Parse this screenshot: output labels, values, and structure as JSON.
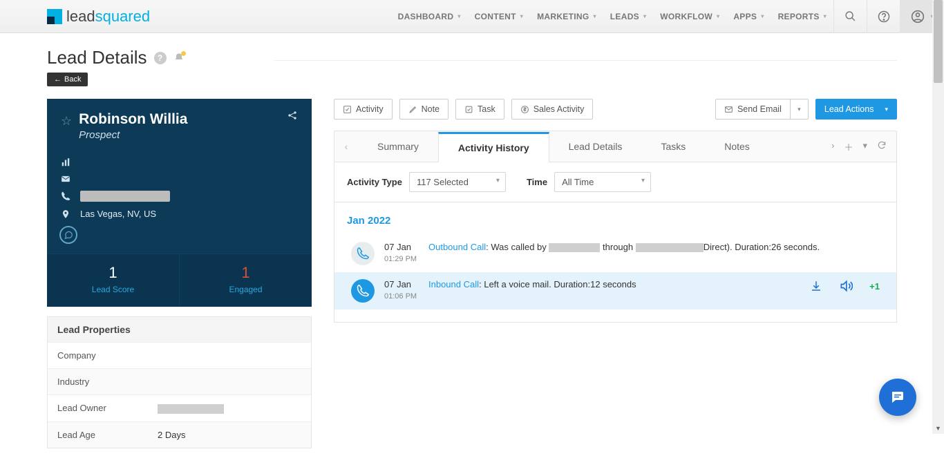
{
  "nav": {
    "brand_a": "lead",
    "brand_b": "squared",
    "items": [
      "DASHBOARD",
      "CONTENT",
      "MARKETING",
      "LEADS",
      "WORKFLOW",
      "APPS",
      "REPORTS"
    ]
  },
  "page": {
    "title": "Lead Details",
    "back": "Back"
  },
  "lead": {
    "name": "Robinson Willia",
    "stage": "Prospect",
    "location": "Las Vegas, NV, US",
    "score": {
      "value": "1",
      "label": "Lead Score"
    },
    "engaged": {
      "value": "1",
      "label": "Engaged"
    }
  },
  "props": {
    "header": "Lead Properties",
    "rows": [
      {
        "key": "Company",
        "val": ""
      },
      {
        "key": "Industry",
        "val": ""
      },
      {
        "key": "Lead Owner",
        "val": "[masked]"
      },
      {
        "key": "Lead Age",
        "val": "2 Days"
      }
    ]
  },
  "actions": {
    "activity": "Activity",
    "note": "Note",
    "task": "Task",
    "sales": "Sales Activity",
    "send_email": "Send Email",
    "lead_actions": "Lead Actions"
  },
  "tabs": [
    "Summary",
    "Activity History",
    "Lead Details",
    "Tasks",
    "Notes"
  ],
  "active_tab": 1,
  "filters": {
    "type_label": "Activity Type",
    "type_value": "117 Selected",
    "time_label": "Time",
    "time_value": "All Time"
  },
  "history": {
    "month": "Jan 2022",
    "rows": [
      {
        "kind": "out",
        "date": "07 Jan",
        "time": "01:29 PM",
        "link": "Outbound Call",
        "text_a": ": Was called by ",
        "mask_a_w": 74,
        "text_b": "through ",
        "mask_b_w": 98,
        "text_c": "Direct). Duration:26 seconds."
      },
      {
        "kind": "in",
        "date": "07 Jan",
        "time": "01:06 PM",
        "link": "Inbound Call",
        "text_a": ": Left a voice mail. Duration:12 seconds",
        "plus": "+1"
      }
    ]
  }
}
